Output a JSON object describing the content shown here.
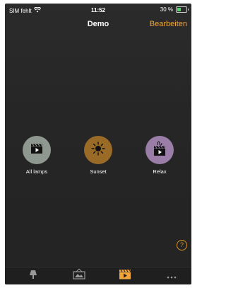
{
  "status_bar": {
    "carrier": "SIM fehlt",
    "time": "11:52",
    "battery": "30 %"
  },
  "nav": {
    "title": "Demo",
    "edit_label": "Bearbeiten"
  },
  "scenes": [
    {
      "label": "All lamps",
      "color": "#8f9791",
      "icon": "clapperboard-icon"
    },
    {
      "label": "Sunset",
      "color": "#9a6b26",
      "icon": "sun-icon"
    },
    {
      "label": "Relax",
      "color": "#9a7ea8",
      "icon": "clapperboard-icon"
    }
  ],
  "help": {
    "symbol": "?"
  },
  "tabs": [
    {
      "name": "lamps-tab",
      "icon": "lamp-icon"
    },
    {
      "name": "pictures-tab",
      "icon": "picture-frame-icon"
    },
    {
      "name": "scenes-tab",
      "icon": "clapperboard-icon"
    },
    {
      "name": "more-tab",
      "icon": "more-dots-icon"
    }
  ],
  "colors": {
    "accent": "#f0a43a",
    "background": "#262626",
    "battery_fill": "#4cd964"
  }
}
